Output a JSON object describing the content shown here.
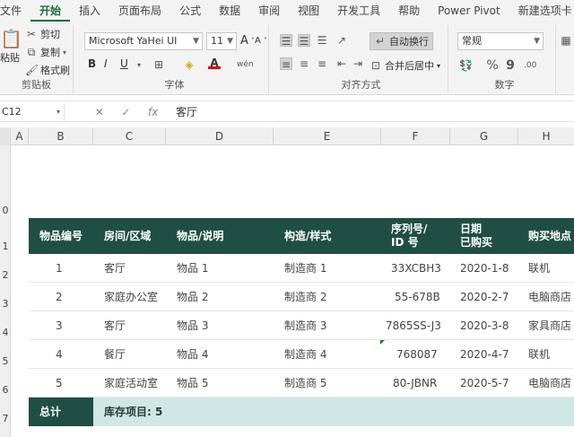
{
  "tabs": [
    "文件",
    "开始",
    "插入",
    "页面布局",
    "公式",
    "数据",
    "审阅",
    "视图",
    "开发工具",
    "帮助",
    "Power Pivot",
    "新建选项卡"
  ],
  "active_tab": "开始",
  "ribbon": {
    "clipboard": {
      "paste": "粘贴",
      "cut": "剪切",
      "copy": "复制",
      "format_painter": "格式刷",
      "label": "剪贴板"
    },
    "font": {
      "name": "Microsoft YaHei UI",
      "size": "11",
      "bold": "B",
      "italic": "I",
      "underline": "U",
      "label": "字体",
      "grow": "A",
      "shrink": "A"
    },
    "alignment": {
      "wrap": "自动换行",
      "merge": "合并后居中",
      "label": "对齐方式"
    },
    "number": {
      "format": "常规",
      "percent": "%",
      "comma": "9",
      "label": "数字"
    }
  },
  "formula_bar": {
    "name_box": "C12",
    "content": "客厅",
    "fx": "fx"
  },
  "columns": [
    "A",
    "B",
    "C",
    "D",
    "E",
    "F",
    "G",
    "H"
  ],
  "rows": [
    "0",
    "1",
    "2",
    "3",
    "4",
    "5",
    "6",
    "7"
  ],
  "table": {
    "headers": [
      {
        "l1": "物品编号",
        "l2": ""
      },
      {
        "l1": "房间/区域",
        "l2": ""
      },
      {
        "l1": "物品/说明",
        "l2": ""
      },
      {
        "l1": "构造/样式",
        "l2": ""
      },
      {
        "l1": "序列号/",
        "l2": "ID 号"
      },
      {
        "l1": "日期",
        "l2": "已购买"
      },
      {
        "l1": "购买地点",
        "l2": ""
      }
    ],
    "rows": [
      [
        "1",
        "客厅",
        "物品 1",
        "制造商 1",
        "33XCBH3",
        "2020-1-8",
        "联机"
      ],
      [
        "2",
        "家庭办公室",
        "物品 2",
        "制造商 2",
        "55-678B",
        "2020-2-7",
        "电脑商店"
      ],
      [
        "3",
        "客厅",
        "物品 3",
        "制造商 3",
        "7865SS-J3",
        "2020-3-8",
        "家具商店"
      ],
      [
        "4",
        "餐厅",
        "物品 4",
        "制造商 4",
        "768087",
        "2020-4-7",
        "联机"
      ],
      [
        "5",
        "家庭活动室",
        "物品 5",
        "制造商 5",
        "80-JBNR",
        "2020-5-7",
        "电脑商店"
      ]
    ],
    "total_label": "总计",
    "total_value": "库存项目: 5"
  },
  "colors": {
    "header_bg": "#1f4e44",
    "total_bg": "#cfe7e5",
    "accent": "#1e6b3c"
  }
}
